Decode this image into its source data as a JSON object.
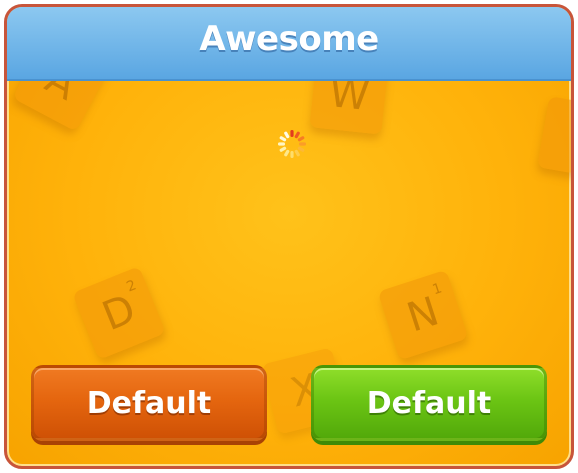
{
  "dialog": {
    "title": "Awesome",
    "buttons": {
      "left_label": "Default",
      "right_label": "Default"
    }
  },
  "background_tiles": [
    {
      "letter": "A",
      "points": ""
    },
    {
      "letter": "W",
      "points": ""
    },
    {
      "letter": "D",
      "points": "2"
    },
    {
      "letter": "N",
      "points": "1"
    },
    {
      "letter": "X",
      "points": ""
    }
  ],
  "colors": {
    "header": "#6fb4e8",
    "body": "#ffb20a",
    "left_button": "#e5660f",
    "right_button": "#6cc514"
  },
  "icons": {
    "spinner": "loading-spinner-icon"
  }
}
